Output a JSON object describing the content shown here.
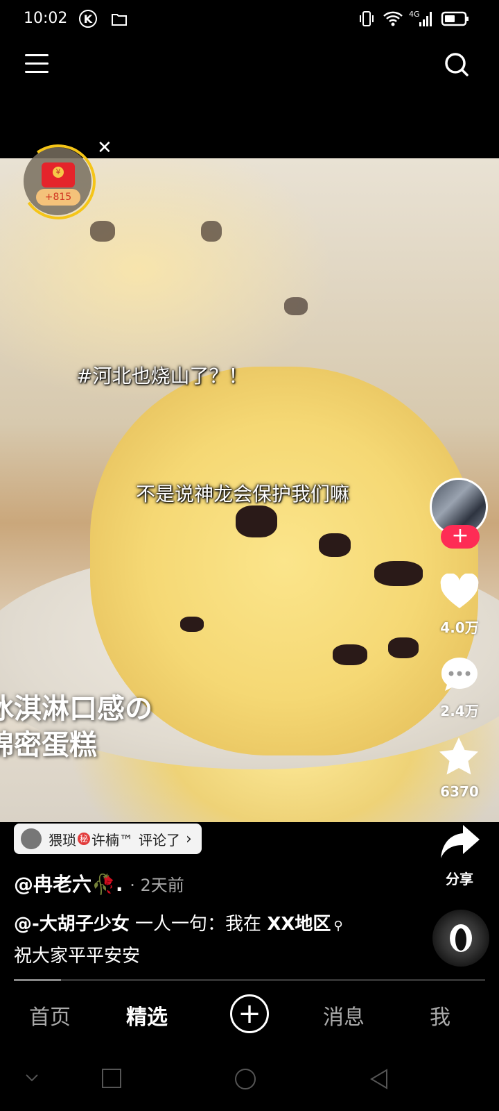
{
  "status_bar": {
    "time": "10:02",
    "network": "4G"
  },
  "video": {
    "caption_top": "#河北也烧山了？！",
    "caption_mid": "不是说神龙会保护我们嘛",
    "overlay_line1": "冰淇淋口感の",
    "overlay_line2": "绵密蛋糕"
  },
  "red_packet": {
    "badge": "+815",
    "coin": "¥"
  },
  "actions": {
    "likes": "4.0万",
    "comments": "2.4万",
    "favorites": "6370",
    "share": "分享"
  },
  "comment_chip": {
    "name_before": "猥琐",
    "secret": "秘",
    "name_after": "许楠™",
    "action": "评论了"
  },
  "post": {
    "author": "@冉老六🥀.",
    "time_ago": "· 2天前",
    "mention": "@-大胡子少女",
    "desc_text": " 一人一句：我在 ",
    "desc_highlight": "XX地区",
    "desc_line2": "祝大家平平安安"
  },
  "progress": 0.1,
  "tabs": [
    {
      "label": "首页",
      "active": false
    },
    {
      "label": "精选",
      "active": true
    },
    {
      "label": "消息",
      "active": false
    },
    {
      "label": "我",
      "active": false
    }
  ]
}
